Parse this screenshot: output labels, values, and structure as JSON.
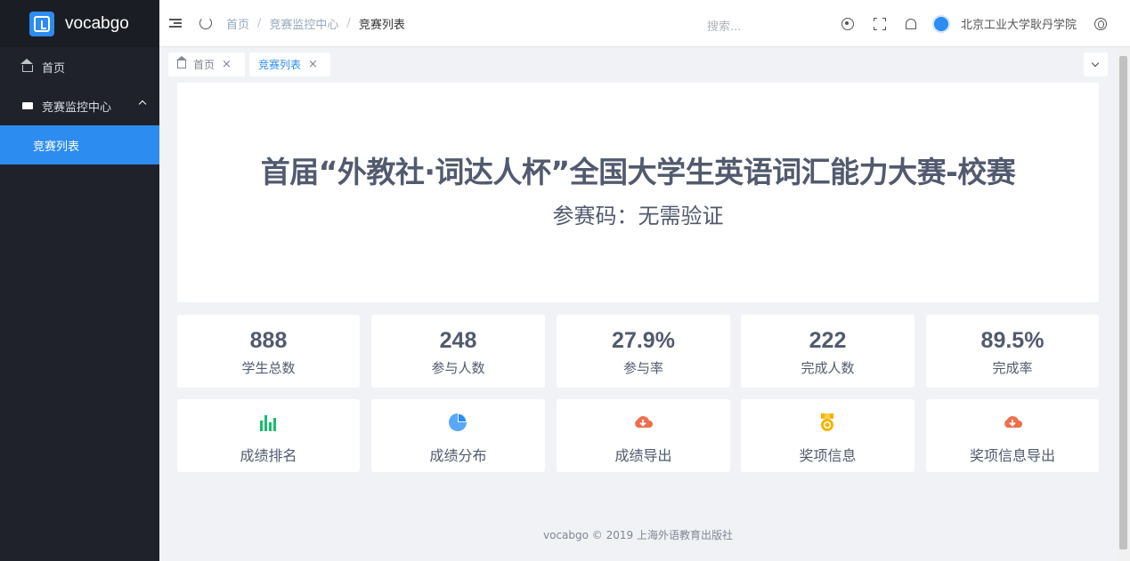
{
  "app": {
    "logo_text": "vocabgo"
  },
  "sidebar": {
    "items": [
      {
        "label": "首页",
        "icon": "home-icon"
      },
      {
        "label": "竞赛监控中心",
        "icon": "monitor-icon",
        "expanded": true,
        "children": [
          {
            "label": "竞赛列表",
            "active": true
          }
        ]
      }
    ]
  },
  "header": {
    "breadcrumb": [
      "首页",
      "竞赛监控中心",
      "竞赛列表"
    ],
    "search_placeholder": "搜索...",
    "user_name": "北京工业大学耿丹学院"
  },
  "tabs": [
    {
      "label": "首页",
      "icon": "home-icon",
      "active": false
    },
    {
      "label": "竞赛列表",
      "active": true
    }
  ],
  "banner": {
    "title": "首届“外教社·词达人杯”全国大学生英语词汇能力大赛-校赛",
    "subtitle": "参赛码：无需验证"
  },
  "stats": [
    {
      "value": "888",
      "label": "学生总数"
    },
    {
      "value": "248",
      "label": "参与人数"
    },
    {
      "value": "27.9%",
      "label": "参与率"
    },
    {
      "value": "222",
      "label": "完成人数"
    },
    {
      "value": "89.5%",
      "label": "完成率"
    }
  ],
  "actions": [
    {
      "label": "成绩排名",
      "icon": "bar-chart-icon",
      "color": "#19be6b"
    },
    {
      "label": "成绩分布",
      "icon": "pie-chart-icon",
      "color": "#2d8cf0"
    },
    {
      "label": "成绩导出",
      "icon": "cloud-download-icon",
      "color": "#ed6f4b"
    },
    {
      "label": "奖项信息",
      "icon": "medal-icon",
      "color": "#f5b400"
    },
    {
      "label": "奖项信息导出",
      "icon": "cloud-download-icon",
      "color": "#ed6f4b"
    }
  ],
  "footer": {
    "text": "vocabgo © 2019 上海外语教育出版社"
  },
  "colors": {
    "sidebar_bg": "#1f222a",
    "accent": "#2d8cf0",
    "text": "#515a6e"
  }
}
